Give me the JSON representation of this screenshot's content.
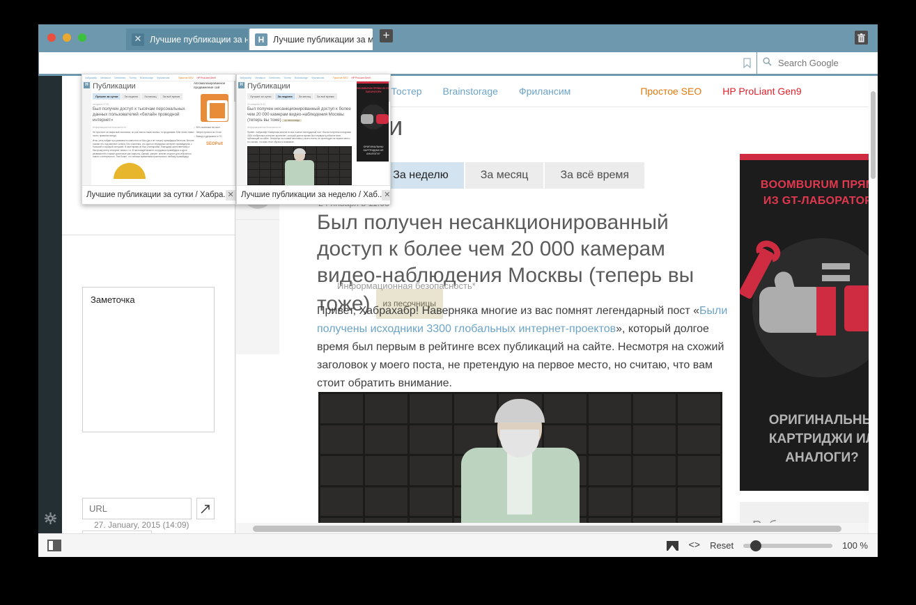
{
  "window": {
    "traffic_lights": [
      "close",
      "minimize",
      "zoom"
    ],
    "trash_icon": "trash-icon",
    "new_tab_label": "+"
  },
  "tabs": [
    {
      "title": "Лучшие публикации за не",
      "close_label": "✕",
      "active": true
    },
    {
      "title": "Лучшие публикации за ме",
      "favicon_label": "H",
      "active": false
    }
  ],
  "search": {
    "placeholder": "Search Google",
    "icon": "search-icon",
    "bookmark_icon": "bookmark-icon"
  },
  "previews": [
    {
      "caption": "Лучшие публикации за сутки / Хабра.",
      "close_label": "✕",
      "page": {
        "heading": "Публикации",
        "filters": [
          "Лучшее за сутки",
          "За неделю",
          "За месяц",
          "За всё время"
        ],
        "active_filter": "Лучшее за сутки",
        "date": "сегодня в 17:39",
        "title": "Был получен доступ к тысячам персональных данных пользователей «билайн проводной интернет»",
        "hub": "Информационная безопасность*",
        "p1": "Не простите за пафосный заголовок, но раз пошла такая пьянка, то продолжим. Мне лично такие посты нравятся всегда.",
        "p2": "Итак, речь пойдет про уязвимость известного в Мск (да и не только) провайдера Вестком. Многие помнят его под именем Corbina. Без сомнения, это один из передовых интернет провайдеров, с большой и хорошей историей. В своё время он был стагнирован, благодаря качественному и быстрому инету, интернет связи и т.п. В настоящий момент сотрудники провайдера и курсе уязвимостей и самые критичные уже закрыты. Однако, уверен, многие откроют для себя много нового и интересного. Тем более, что техника применима практически к любому провайдеру.",
        "ad_title": "Автоматизированное продвижение сай",
        "ad_items": [
          "50% экономии на ссыл",
          "Запуск проекта за 10 ми",
          "Вывод и удержание в ТО"
        ],
        "ad_brand": "SEOPult"
      }
    },
    {
      "caption": "Лучшие публикации за неделю / Хаб..",
      "close_label": "✕",
      "page": {
        "heading": "Публикации",
        "filters": [
          "Лучшие за сутки",
          "За неделю",
          "За месяц",
          "За всё время"
        ],
        "active_filter": "За неделю",
        "date": "24 января в 11:03",
        "title": "Был получен несанкционированный доступ к более чем 20 000 камерам видео-наблюдения Москвы (теперь вы тоже)",
        "tag": "из песочницы",
        "hub": "Информационная безопасность*",
        "p1": "Привет, Хабрахабр! Наверняка многие из вас помнят легендарный пост «Были получены исходники 3300 глобальных интернет-проектов», который долгое время был первым в рейтинге всех публикаций на сайте. Несмотря на схожий заголовок у моего поста, не претендую на первое место, но считаю, что вам стоит обратить внимание.",
        "ad_top": "BOOMBURUM ПРЯМИ ИЗ GT-ЛАБОРАТОРИ",
        "ad_bottom": "ОРИГИНАЛЬНЫ КАРТРИДЖИ ИЛ АНАЛОГИ?"
      }
    }
  ],
  "notes": {
    "note_text": "Заметочка",
    "url_placeholder": "URL",
    "open_icon": "external-link-icon",
    "add_image_icon": "add-photo-icon",
    "date": "27. January, 2015 (14:09)",
    "settings_icon": "gear-icon"
  },
  "page": {
    "site_logo": "H",
    "rail_icons": [
      "hamburger-icon",
      "lock-icon",
      "hp-logo-icon"
    ],
    "nav": [
      {
        "label": "ktimes",
        "style": "link"
      },
      {
        "label": "Тостер",
        "style": "link"
      },
      {
        "label": "Brainstorage",
        "style": "link"
      },
      {
        "label": "Фрилансим",
        "style": "link"
      },
      {
        "label": "Простое SEO",
        "style": "orange"
      },
      {
        "label": "HP ProLiant Gen9",
        "style": "red"
      }
    ],
    "heading": "икации",
    "filters": [
      {
        "label": "сутки",
        "active": false
      },
      {
        "label": "За неделю",
        "active": true
      },
      {
        "label": "За месяц",
        "active": false
      },
      {
        "label": "За всё время",
        "active": false
      }
    ],
    "post": {
      "date": "24 января в 11:03",
      "title": "Был получен несанкционированный доступ к более чем 20 000 камерам видео-наблюдения Москвы (теперь вы тоже)",
      "tag": "из песочницы",
      "hub": "Информационная безопасность*",
      "body_before": "Привет, Хабрахабр! Наверняка многие из вас помнят легендарный пост «",
      "body_link": "Были получены исходники 3300 глобальных интернет-проектов",
      "body_after": "», который долгое время был первым в рейтинге всех публикаций на сайте. Несмотря на схожий заголовок у моего поста, не претендую на первое место, но считаю, что вам стоит обратить внимание."
    },
    "ad": {
      "top_line1": "BOOMBURUM ПРЯМИ",
      "top_line2": "ИЗ GT-ЛАБОРАТОРИ",
      "bottom_line1": "ОРИГИНАЛЬНЫ",
      "bottom_line2": "КАРТРИДЖИ ИЛ",
      "bottom_line3": "АНАЛОГИ?"
    },
    "rubriki": "Рубрики"
  },
  "statusbar": {
    "toggle_icon": "sidebar-toggle-icon",
    "image_icon": "image-icon",
    "code_icon": "<>",
    "reset_label": "Reset",
    "zoom_value": "100 %"
  },
  "colors": {
    "chrome_blue": "#6d98ad",
    "active_tab": "#5d8ba2",
    "rail_dark": "#242f34",
    "filter_active": "#d3e4f0",
    "link_blue": "#6ca4c9",
    "orange": "#e2780d",
    "red": "#e0202a",
    "ad_red": "#cf2b41"
  }
}
